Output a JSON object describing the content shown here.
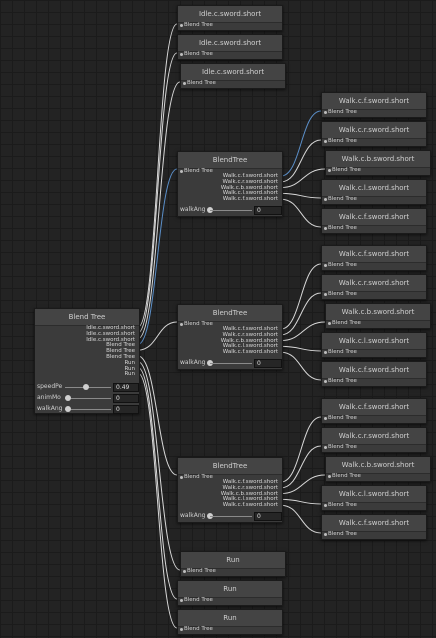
{
  "root": {
    "title": "Blend Tree",
    "outputs": [
      "Idle.c.sword.short",
      "Idle.c.sword.short",
      "Idle.c.sword.short",
      "Blend Tree",
      "Blend Tree",
      "Blend Tree",
      "Run",
      "Run",
      "Run"
    ],
    "params": [
      {
        "name": "speedPe",
        "value": "0.49",
        "slider": 0.45
      },
      {
        "name": "animMo",
        "value": "0",
        "slider": 0.0
      },
      {
        "name": "walkAng",
        "value": "0",
        "slider": 0.0
      }
    ]
  },
  "top_idle": [
    {
      "title": "Idle.c.sword.short",
      "input": "Blend Tree"
    },
    {
      "title": "Idle.c.sword.short",
      "input": "Blend Tree"
    },
    {
      "title": "Idle.c.sword.short",
      "input": "Blend Tree"
    }
  ],
  "blendtrees": [
    {
      "title": "BlendTree",
      "input": "Blend Tree",
      "outputs": [
        "Walk.c.f.sword.short",
        "Walk.c.r.sword.short",
        "Walk.c.b.sword.short",
        "Walk.c.l.sword.short",
        "Walk.c.f.sword.short"
      ],
      "param": {
        "name": "walkAng",
        "value": "0"
      }
    },
    {
      "title": "BlendTree",
      "input": "Blend Tree",
      "outputs": [
        "Walk.c.f.sword.short",
        "Walk.c.r.sword.short",
        "Walk.c.b.sword.short",
        "Walk.c.l.sword.short",
        "Walk.c.f.sword.short"
      ],
      "param": {
        "name": "walkAng",
        "value": "0"
      }
    },
    {
      "title": "BlendTree",
      "input": "Blend Tree",
      "outputs": [
        "Walk.c.f.sword.short",
        "Walk.c.r.sword.short",
        "Walk.c.b.sword.short",
        "Walk.c.l.sword.short",
        "Walk.c.f.sword.short"
      ],
      "param": {
        "name": "walkAng",
        "value": "0"
      }
    }
  ],
  "walk_groups": [
    [
      {
        "title": "Walk.c.f.sword.short",
        "input": "Blend Tree"
      },
      {
        "title": "Walk.c.r.sword.short",
        "input": "Blend Tree"
      },
      {
        "title": "Walk.c.b.sword.short",
        "input": "Blend Tree"
      },
      {
        "title": "Walk.c.l.sword.short",
        "input": "Blend Tree"
      },
      {
        "title": "Walk.c.f.sword.short",
        "input": "Blend Tree"
      }
    ],
    [
      {
        "title": "Walk.c.f.sword.short",
        "input": "Blend Tree"
      },
      {
        "title": "Walk.c.r.sword.short",
        "input": "Blend Tree"
      },
      {
        "title": "Walk.c.b.sword.short",
        "input": "Blend Tree"
      },
      {
        "title": "Walk.c.l.sword.short",
        "input": "Blend Tree"
      },
      {
        "title": "Walk.c.f.sword.short",
        "input": "Blend Tree"
      }
    ],
    [
      {
        "title": "Walk.c.f.sword.short",
        "input": "Blend Tree"
      },
      {
        "title": "Walk.c.r.sword.short",
        "input": "Blend Tree"
      },
      {
        "title": "Walk.c.b.sword.short",
        "input": "Blend Tree"
      },
      {
        "title": "Walk.c.l.sword.short",
        "input": "Blend Tree"
      },
      {
        "title": "Walk.c.f.sword.short",
        "input": "Blend Tree"
      }
    ]
  ],
  "run_nodes": [
    {
      "title": "Run",
      "input": "Blend Tree"
    },
    {
      "title": "Run",
      "input": "Blend Tree"
    },
    {
      "title": "Run",
      "input": "Blend Tree"
    }
  ],
  "colors": {
    "wire": "#d8d8d8",
    "wire_active": "#5b8fc9",
    "node_bg": "#3b3b3b",
    "canvas": "#232323"
  }
}
